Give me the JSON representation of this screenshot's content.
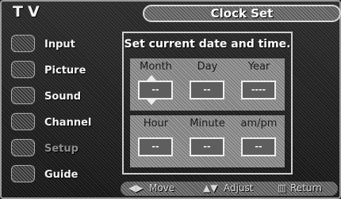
{
  "top": {
    "tv_label": "TV",
    "title": "Clock Set"
  },
  "sidebar": {
    "items": [
      {
        "label": "Input",
        "icon": "input-icon"
      },
      {
        "label": "Picture",
        "icon": "picture-icon"
      },
      {
        "label": "Sound",
        "icon": "sound-icon"
      },
      {
        "label": "Channel",
        "icon": "channel-icon"
      },
      {
        "label": "Setup",
        "icon": "setup-icon"
      },
      {
        "label": "Guide",
        "icon": "guide-icon"
      }
    ]
  },
  "panel": {
    "heading": "Set current date and time.",
    "date_labels": {
      "month": "Month",
      "day": "Day",
      "year": "Year"
    },
    "date_values": {
      "month": "--",
      "day": "--",
      "year": "----"
    },
    "time_labels": {
      "hour": "Hour",
      "minute": "Minute",
      "ampm": "am/pm"
    },
    "time_values": {
      "hour": "--",
      "minute": "--",
      "ampm": "--"
    }
  },
  "bottom": {
    "move": "Move",
    "adjust": "Adjust",
    "return": "Return"
  }
}
